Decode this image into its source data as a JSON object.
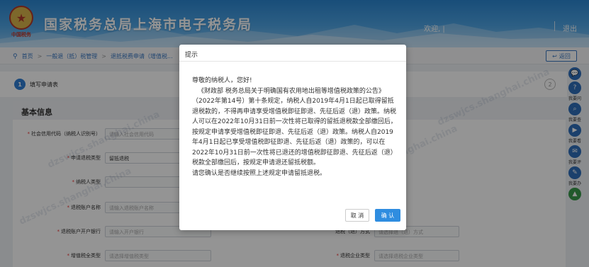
{
  "header": {
    "title": "国家税务总局上海市电子税务局",
    "emblem_text": "中国税务",
    "welcome": "欢迎, |",
    "logout": "退出"
  },
  "breadcrumb": {
    "items": [
      "首页",
      "一般退（抵）税管理",
      "退抵税费申请（增值税..."
    ],
    "back_label": "返回"
  },
  "steps": {
    "current_number": "1",
    "current_label": "填写申请表",
    "next_number": "2"
  },
  "form": {
    "section_title": "基本信息",
    "fields": [
      {
        "label": "社会信用代码（纳税人识别号）",
        "required": true,
        "value": "请输入社会信用代码"
      },
      {
        "label": "申请退税类型",
        "required": true,
        "value": "留抵退税"
      },
      {
        "label": "纳税人类型",
        "required": true,
        "value": ""
      },
      {
        "label": "退税账户名称",
        "required": true,
        "value": "请输入退税账户名称"
      },
      {
        "label": "退税账户开户银行",
        "required": true,
        "value": "请输入开户银行"
      },
      {
        "label": "增值税全类型",
        "required": true,
        "value": "请选择增值税类型"
      }
    ],
    "right_fields": [
      {
        "label": "退税（退）方式",
        "value": "请选择退（退）方式"
      },
      {
        "label": "退税企业类型",
        "value": "请选择退税企业类型"
      }
    ]
  },
  "watermark": "dzswjcs.shanghai.china",
  "side_tools": [
    {
      "icon": "chat-icon",
      "glyph": "💬",
      "label": ""
    },
    {
      "icon": "question-icon",
      "glyph": "?",
      "label": "我要问"
    },
    {
      "icon": "search-icon",
      "glyph": "⌕",
      "label": "我要查"
    },
    {
      "icon": "video-icon",
      "glyph": "▶",
      "label": "我要看"
    },
    {
      "icon": "comment-icon",
      "glyph": "✉",
      "label": "我要评"
    },
    {
      "icon": "handle-icon",
      "glyph": "✎",
      "label": "我要办"
    },
    {
      "icon": "top-icon",
      "glyph": "▲",
      "label": ""
    }
  ],
  "dialog": {
    "title": "提示",
    "greeting": "尊敬的纳税人，您好!",
    "paragraph1": "《财政部 税务总局关于明确国有农用地出租等增值税政策的公告》（2022年第14号）第十条规定，纳税人自2019年4月1日起已取得留抵退税款的，不得再申请享受增值税即征即退、先征后返（退）政策。纳税人可以在2022年10月31日前一次性将已取得的留抵退税款全部缴回后，按规定申请享受增值税即征即退、先征后返（退）政策。纳税人自2019年4月1日起已享受增值税即征即退、先征后返（退）政策的，可以在2022年10月31日前一次性将已退还的增值税即征即退、先征后返（退）税款全部缴回后，按规定申请退还留抵税额。",
    "paragraph2": "请您确认是否继续按照上述规定申请留抵退税。",
    "cancel_label": "取 消",
    "ok_label": "确 认"
  },
  "colors": {
    "primary": "#2f8de0",
    "header_blue": "#2b86d1",
    "link": "#3a78c2"
  }
}
